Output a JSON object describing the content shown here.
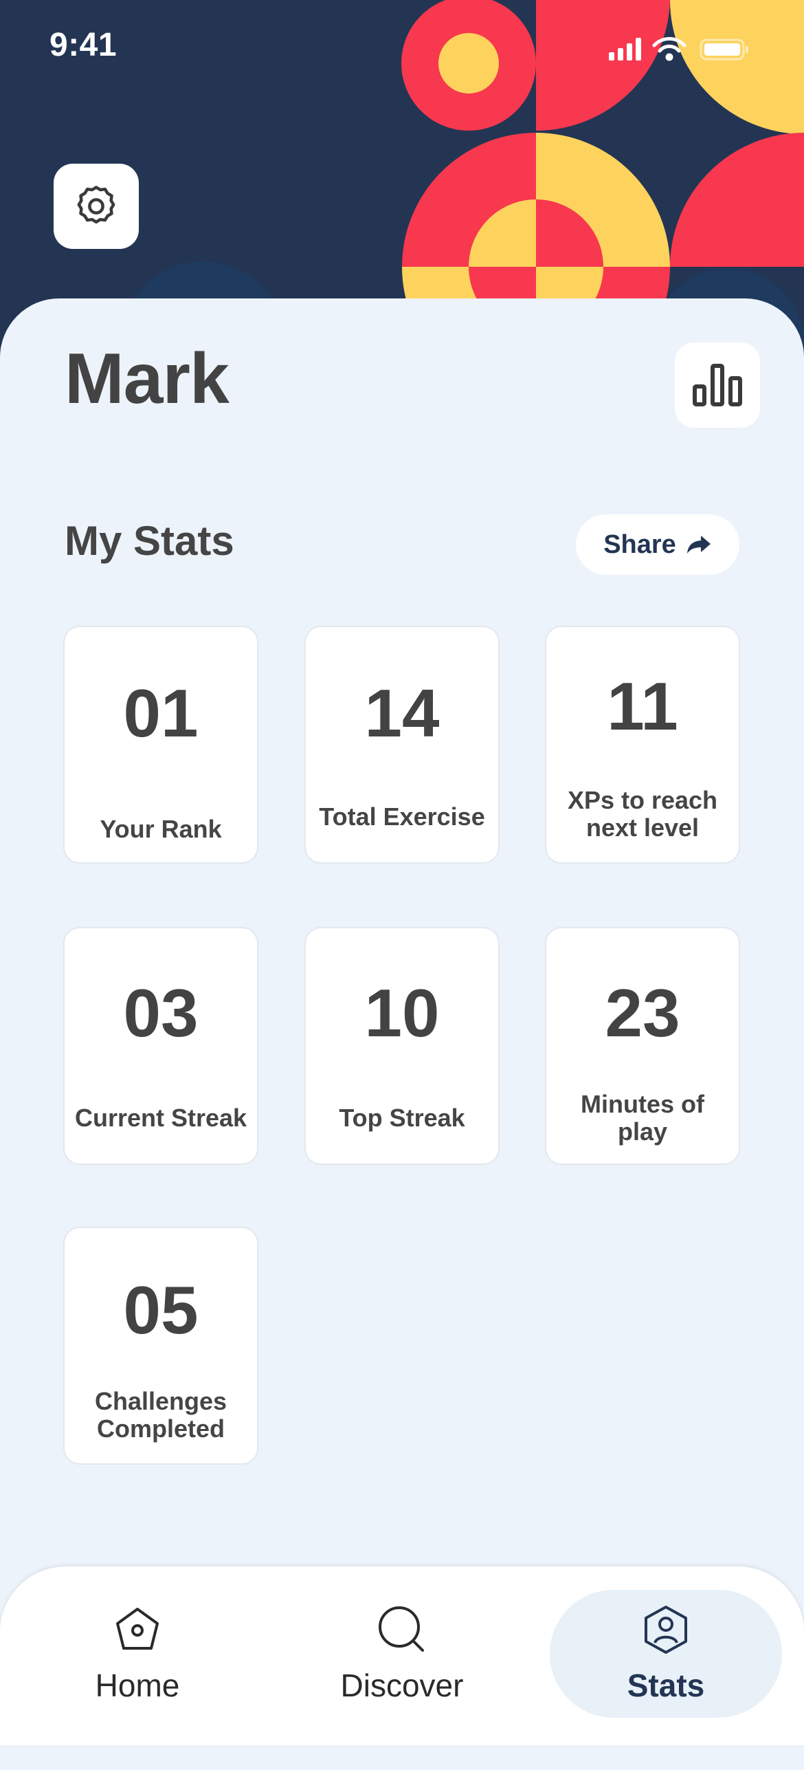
{
  "status_bar": {
    "time": "9:41"
  },
  "header": {
    "user_name": "Mark"
  },
  "stats": {
    "title": "My Stats",
    "share_label": "Share",
    "cards": [
      {
        "value": "01",
        "label": "Your Rank"
      },
      {
        "value": "14",
        "label": "Total Exercise"
      },
      {
        "value": "11",
        "label": "XPs to reach next level"
      },
      {
        "value": "03",
        "label": "Current Streak"
      },
      {
        "value": "10",
        "label": "Top Streak"
      },
      {
        "value": "23",
        "label": "Minutes of play"
      },
      {
        "value": "05",
        "label": "Challenges Completed"
      }
    ]
  },
  "nav": {
    "items": [
      {
        "label": "Home",
        "icon": "home-icon"
      },
      {
        "label": "Discover",
        "icon": "search-icon"
      },
      {
        "label": "Stats",
        "icon": "user-icon",
        "active": true
      }
    ]
  },
  "colors": {
    "navy": "#233553",
    "red": "#f7384e",
    "yellow": "#fdd35e",
    "background": "#edf3fa",
    "text": "#434343"
  }
}
